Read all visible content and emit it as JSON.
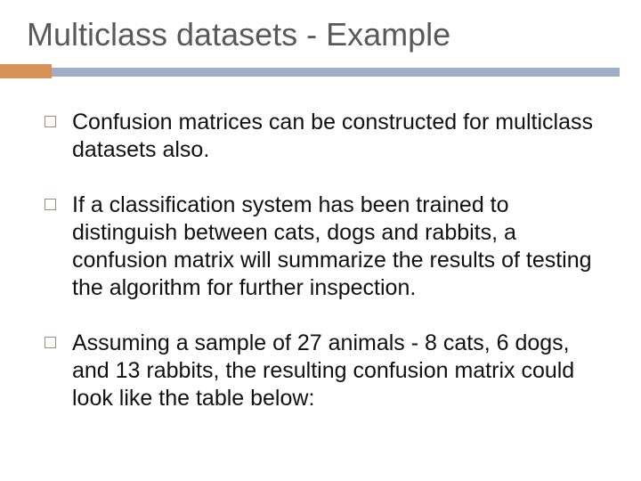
{
  "slide": {
    "title": "Multiclass datasets - Example",
    "bullets": [
      "Confusion matrices can be constructed for multiclass datasets also.",
      "If a classification system has been trained to distinguish between cats, dogs and rabbits, a confusion matrix will summarize the results of testing the algorithm for further inspection.",
      "Assuming a sample of 27 animals - 8 cats, 6 dogs, and 13 rabbits, the resulting confusion matrix could look like the table below:"
    ]
  }
}
